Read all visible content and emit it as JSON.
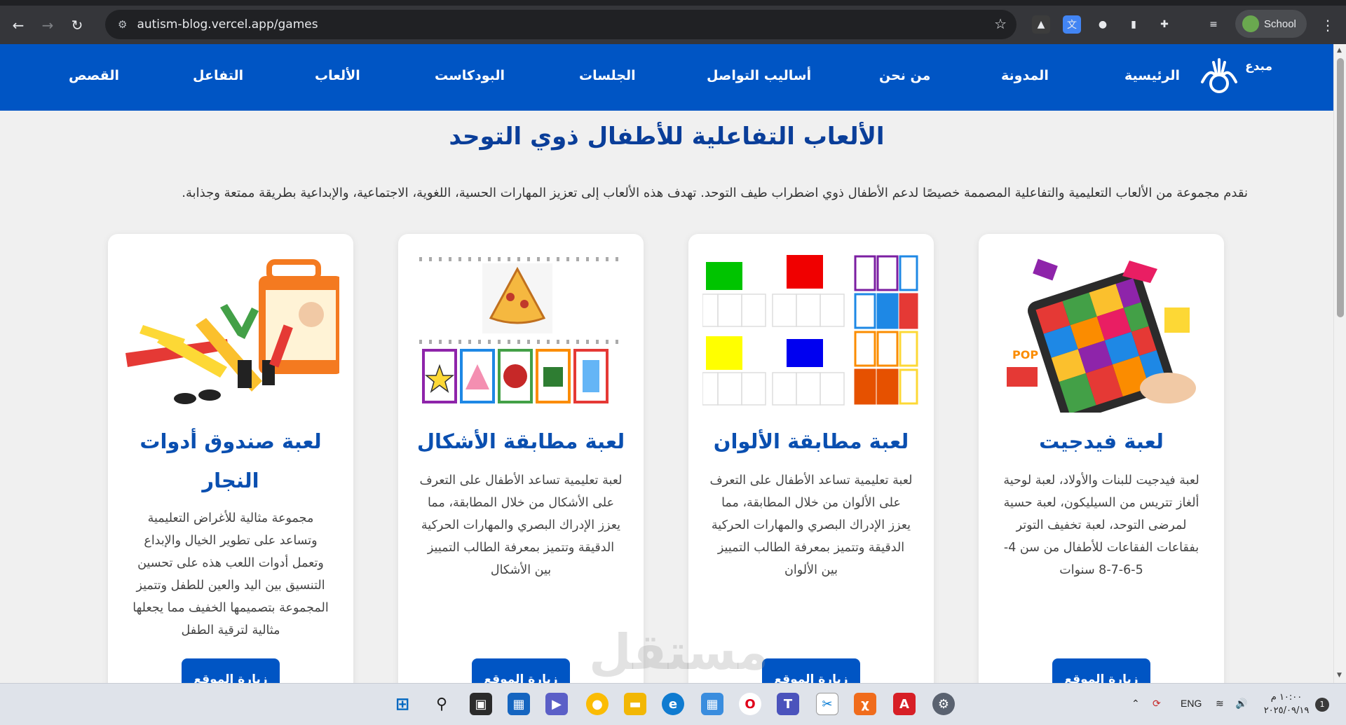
{
  "browser": {
    "url": "autism-blog.vercel.app/games",
    "profile_label": "School"
  },
  "site": {
    "logo_text": "مبدع",
    "nav": [
      "الرئيسية",
      "المدونة",
      "من نحن",
      "أساليب التواصل",
      "الجلسات",
      "البودكاست",
      "الألعاب",
      "التفاعل",
      "القصص"
    ]
  },
  "main": {
    "title": "الألعاب التفاعلية للأطفال ذوي التوحد",
    "intro": "نقدم مجموعة من الألعاب التعليمية والتفاعلية المصممة خصيصًا لدعم الأطفال ذوي اضطراب طيف التوحد. تهدف هذه الألعاب إلى تعزيز المهارات الحسية، اللغوية، الاجتماعية، والإبداعية بطريقة ممتعة وجذابة."
  },
  "cards": [
    {
      "title": "لعبة فيدجيت",
      "desc": "لعبة فيدجيت للبنات والأولاد، لعبة لوحية ألغاز تتريس من السيليكون، لعبة حسية لمرضى التوحد، لعبة تخفيف التوتر بفقاعات الفقاعات للأطفال من سن 4-5-6-7-8 سنوات",
      "button": "زيارة الموقع"
    },
    {
      "title": "لعبة مطابقة الألوان",
      "desc": "لعبة تعليمية تساعد الأطفال على التعرف على الألوان من خلال المطابقة، مما يعزز الإدراك البصري والمهارات الحركية الدقيقة وتتميز بمعرفة الطالب التمييز بين الألوان",
      "button": "زيارة الموقع"
    },
    {
      "title": "لعبة مطابقة الأشكال",
      "desc": "لعبة تعليمية تساعد الأطفال على التعرف على الأشكال من خلال المطابقة، مما يعزز الإدراك البصري والمهارات الحركية الدقيقة وتتميز بمعرفة الطالب التمييز بين الأشكال",
      "button": "زيارة الموقع"
    },
    {
      "title": "لعبة صندوق أدوات النجار",
      "desc": "مجموعة مثالية للأغراض التعليمية وتساعد على تطوير الخيال والإبداع وتعمل أدوات اللعب هذه على تحسين التنسيق بين اليد والعين للطفل وتتميز المجموعة بتصميمها الخفيف مما يجعلها مثالية لترقية الطفل",
      "button": "زيارة الموقع"
    }
  ],
  "watermark": "مستقل",
  "taskbar": {
    "lang": "ENG",
    "time": "١٠:٠٠ م",
    "date": "٢٠٢٥/٠٩/١٩",
    "notifications": "1"
  },
  "colors": {
    "brand_blue": "#0055c4",
    "title_blue": "#0a3e99"
  }
}
